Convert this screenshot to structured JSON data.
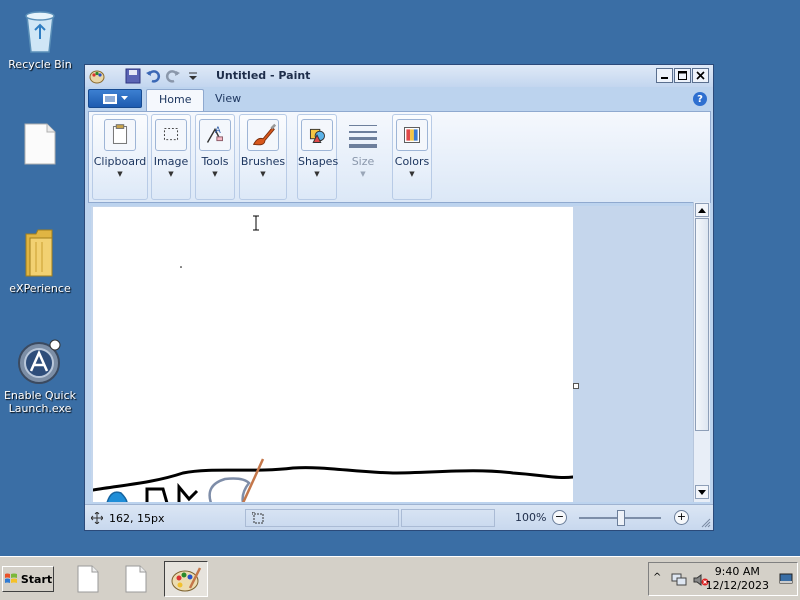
{
  "desktop": {
    "icons": [
      {
        "label": "Recycle Bin",
        "icon": "recycle-bin-icon"
      },
      {
        "label": "",
        "icon": "blank-file-icon"
      },
      {
        "label": "eXPerience",
        "icon": "folder-icon"
      },
      {
        "label": "Enable Quick Launch.exe",
        "icon": "quick-launch-app-icon"
      }
    ]
  },
  "window": {
    "title": "Untitled - Paint",
    "tabs": [
      {
        "label": "Home",
        "active": true
      },
      {
        "label": "View",
        "active": false
      }
    ],
    "ribbon": {
      "groups": [
        {
          "label": "Clipboard",
          "icon": "clipboard-icon"
        },
        {
          "label": "Image",
          "icon": "select-icon"
        },
        {
          "label": "Tools",
          "icon": "tools-icon"
        },
        {
          "label": "Brushes",
          "icon": "brush-icon"
        },
        {
          "label": "Shapes",
          "icon": "shapes-icon"
        },
        {
          "label": "Size",
          "icon": "size-icon",
          "disabled": true
        },
        {
          "label": "Colors",
          "icon": "colors-icon"
        }
      ]
    },
    "status": {
      "cursor_position": "162, 15px",
      "zoom": "100%"
    }
  },
  "taskbar": {
    "start_label": "Start",
    "clock_time": "9:40 AM",
    "clock_date": "12/12/2023"
  },
  "colors": {
    "desktop": "#3a6ea5",
    "ribbon_accent": "#1d5bb0",
    "stroke": "#000000"
  }
}
